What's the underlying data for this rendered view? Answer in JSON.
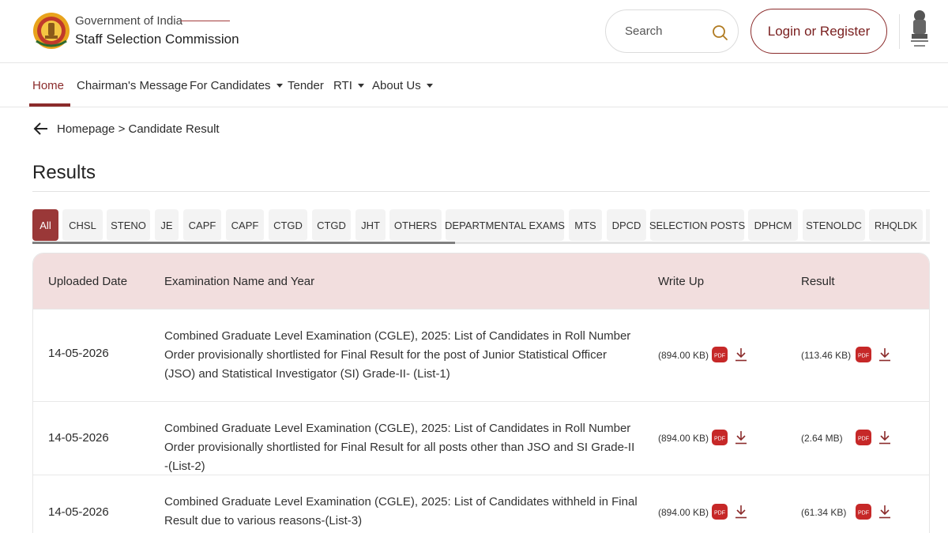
{
  "header": {
    "org_line1": "Government of India",
    "org_line2": "Staff Selection Commission",
    "search_placeholder": "Search",
    "login_label": "Login or Register",
    "logo_icon": "ssc-logo-icon",
    "emblem_icon": "national-emblem-icon"
  },
  "nav": {
    "items": [
      {
        "label": "Home",
        "active": true
      },
      {
        "label": "Chairman's Message"
      },
      {
        "label": "For Candidates",
        "dropdown": true
      },
      {
        "label": "Tender"
      },
      {
        "label": "RTI",
        "dropdown": true
      },
      {
        "label": "About Us",
        "dropdown": true
      }
    ]
  },
  "breadcrumb": {
    "home": "Homepage",
    "separator": ">",
    "current": "Candidate Result"
  },
  "page_title": "Results",
  "tabs": [
    {
      "label": "All",
      "active": true
    },
    {
      "label": "CHSL"
    },
    {
      "label": "STENO"
    },
    {
      "label": "JE"
    },
    {
      "label": "CAPF"
    },
    {
      "label": "CAPF"
    },
    {
      "label": "CTGD"
    },
    {
      "label": "CTGD"
    },
    {
      "label": "JHT"
    },
    {
      "label": "OTHERS"
    },
    {
      "label": "DEPARTMENTAL EXAMS"
    },
    {
      "label": "MTS"
    },
    {
      "label": "DPCD"
    },
    {
      "label": "SELECTION POSTS"
    },
    {
      "label": "DPHCM"
    },
    {
      "label": "STENOLDC"
    },
    {
      "label": "RHQLDK"
    }
  ],
  "table": {
    "headers": {
      "date": "Uploaded Date",
      "name": "Examination Name and Year",
      "writeup": "Write Up",
      "result": "Result"
    },
    "rows": [
      {
        "date": "14-05-2026",
        "name": "Combined Graduate Level Examination (CGLE), 2025: List of Candidates in Roll Number Order provisionally shortlisted for Final Result for the post of Junior Statistical Officer (JSO) and Statistical Investigator (SI) Grade-II- (List-1)",
        "writeup_size": "(894.00 KB)",
        "result_size": "(113.46 KB)"
      },
      {
        "date": "14-05-2026",
        "name": "Combined Graduate Level Examination (CGLE), 2025: List of Candidates in Roll Number Order provisionally shortlisted for Final Result for all posts other than JSO and SI Grade-II -(List-2)",
        "writeup_size": "(894.00 KB)",
        "result_size": "(2.64 MB)"
      },
      {
        "date": "14-05-2026",
        "name": "Combined Graduate Level Examination (CGLE), 2025: List of Candidates withheld in Final Result due to various reasons-(List-3)",
        "writeup_size": "(894.00 KB)",
        "result_size": "(61.34 KB)"
      }
    ],
    "pdf_label": "PDF"
  },
  "colors": {
    "brand": "#8b2b2b",
    "active_tab": "#9a3838",
    "table_header_bg": "#f2dede",
    "pdf_red": "#c62828"
  }
}
